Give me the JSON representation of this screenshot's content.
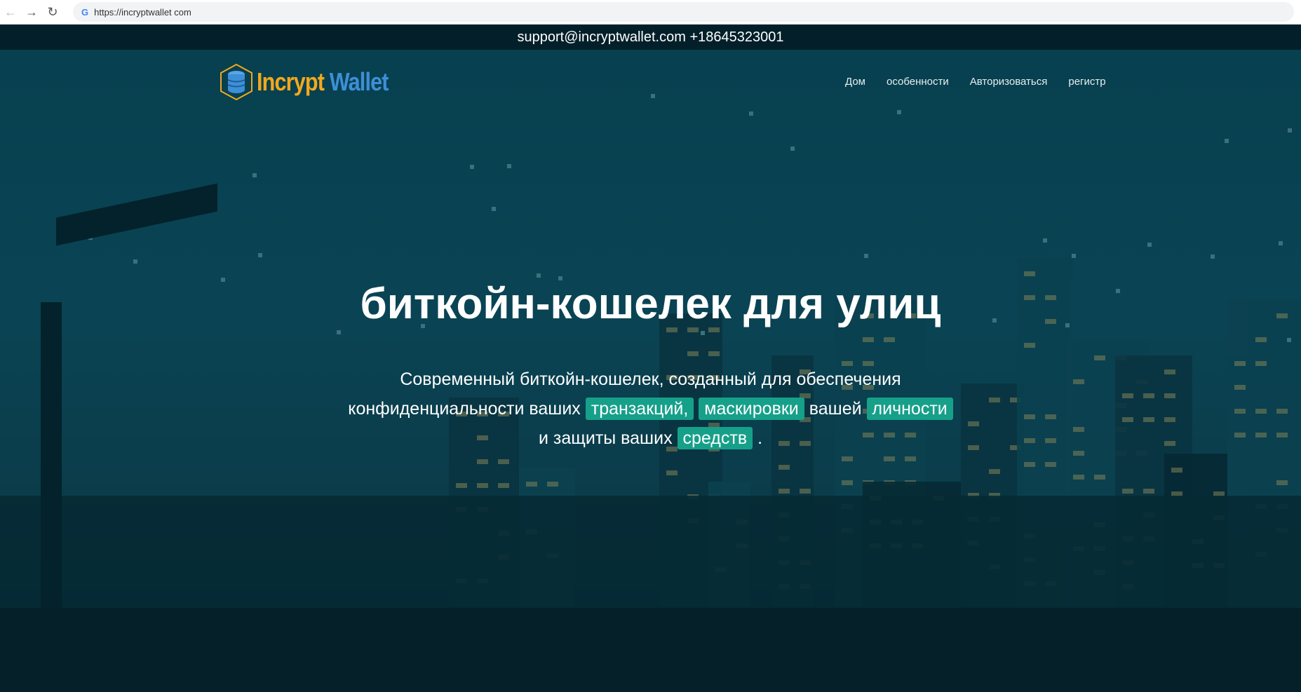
{
  "browser": {
    "url": "https://incryptwallet com"
  },
  "topbar": {
    "contact": "support@incryptwallet.com +18645323001"
  },
  "logo": {
    "part1": "Incrypt",
    "part2": "Wallet",
    "color1": "#f2a81d",
    "color2": "#3d8fd6"
  },
  "nav": [
    {
      "label": "Дом"
    },
    {
      "label": "особенности"
    },
    {
      "label": "Авторизоваться"
    },
    {
      "label": "регистр"
    }
  ],
  "hero": {
    "title": "биткойн-кошелек для улиц",
    "line1": "Современный биткойн-кошелек, созданный для обеспечения",
    "line2_a": "конфиденциальности ваших",
    "hl1": "транзакций,",
    "hl2": "маскировки",
    "line2_b": "вашей",
    "hl3": "личности",
    "line3_a": "и защиты ваших",
    "hl4": "средств",
    "line3_b": ".",
    "accent": "#16a08a"
  }
}
